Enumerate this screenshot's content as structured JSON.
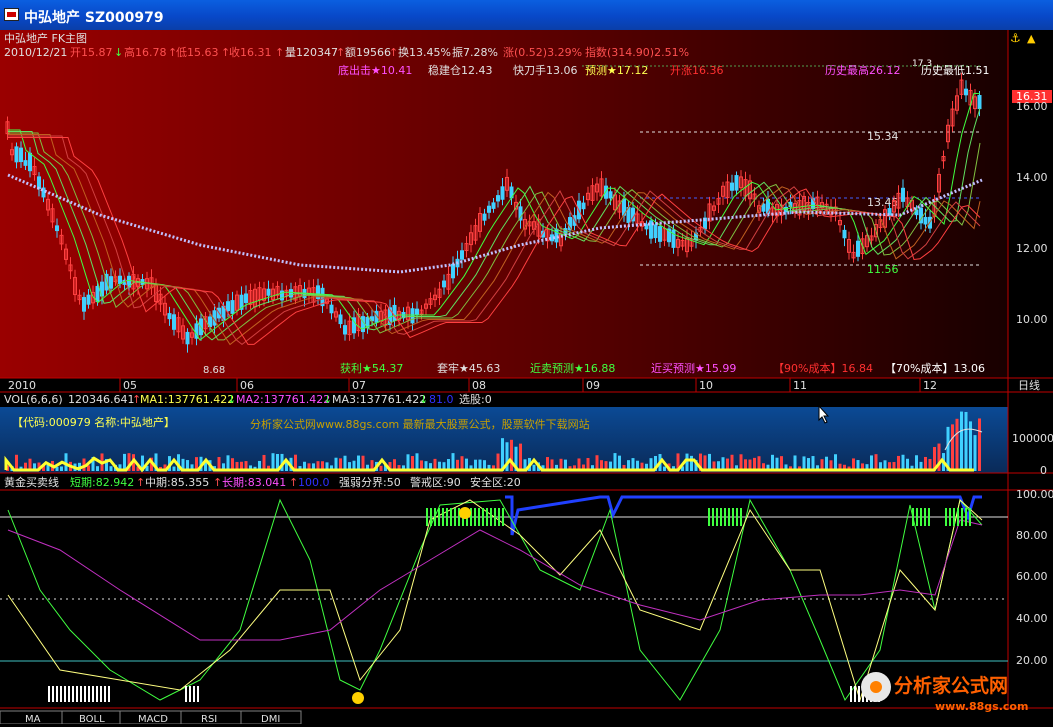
{
  "window": {
    "title": "中弘地产  SZ000979"
  },
  "header": {
    "line1": "中弘地产 FK主图",
    "date": "2010/12/21",
    "open": "开15.87",
    "arr1": "↓",
    "high": "高16.78",
    "arr2": "↑",
    "low": "低15.63",
    "arr3": "↑",
    "close": "收16.31",
    "arr4": "↑",
    "vol": "量120347",
    "arr5": "↑",
    "amt": "额19566",
    "arr6": "↑",
    "turn": "换13.45%",
    "amp": "振7.28%",
    "chg": "涨(0.52)3.29%",
    "idx": "指数(314.90)2.51%"
  },
  "main_labels": {
    "l1": "底出击★10.41",
    "l2": "稳建仓12.43",
    "l3": "快刀手13.06",
    "l4": "预测★17.12",
    "l5": "开涨16.36",
    "l6": "历史最高26.12",
    "l7": "历史最低1.51",
    "l8": "获利★54.37",
    "l9": "套牢★45.63",
    "l10": "近卖预测★16.88",
    "l11": "近买预测★15.99",
    "l12": "【90%成本】16.84",
    "l13": "【70%成本】13.06",
    "lv1": "15.34",
    "lv2": "13.45",
    "lv3": "11.56",
    "lv4": "8.68",
    "lv5": "17.3"
  },
  "price_axis": {
    "current": "16.31",
    "ticks": [
      "16.00",
      "14.00",
      "12.00",
      "10.00"
    ]
  },
  "date_axis": {
    "labels": [
      "2010",
      "05",
      "06",
      "07",
      "08",
      "09",
      "10",
      "11",
      "12"
    ],
    "end": "日线"
  },
  "vol_panel": {
    "title": "VOL(6,6,6)",
    "v0": "120346.641",
    "a1": "↑",
    "ma1": "MA1:137761.422",
    "a2": "↓",
    "ma2": "MA2:137761.422",
    "a3": "↓",
    "ma3": "MA3:137761.422",
    "a4": "↓",
    "x": "81.0",
    "sel": "选股:0",
    "code": "【代码:000979 名称:中弘地产】",
    "ad": "分析家公式网www.88gs.com 最新最大股票公式，股票软件下载网站",
    "ticks": [
      "100000",
      "0"
    ]
  },
  "ind_panel": {
    "title": "黄金买卖线",
    "short": "短期:82.942",
    "a1": "↑",
    "mid": "中期:85.355",
    "a2": "↑",
    "long": "长期:83.041",
    "a3": "↑",
    "x": "100.0",
    "strong": "强弱分界:50",
    "warn": "警戒区:90",
    "safe": "安全区:20",
    "ticks": [
      "100.00",
      "80.00",
      "60.00",
      "40.00",
      "20.00"
    ]
  },
  "tabs": [
    "MA",
    "BOLL",
    "MACD",
    "RSI",
    "DMI"
  ],
  "logo": {
    "name": "分析家公式网",
    "url": "www.88gs.com"
  },
  "colors": {
    "up": "#ff4040",
    "down": "#40d0ff",
    "bg_top": "#8c0000",
    "vol_bg": "#0a3a78",
    "ind_grid": "#7a0000"
  }
}
